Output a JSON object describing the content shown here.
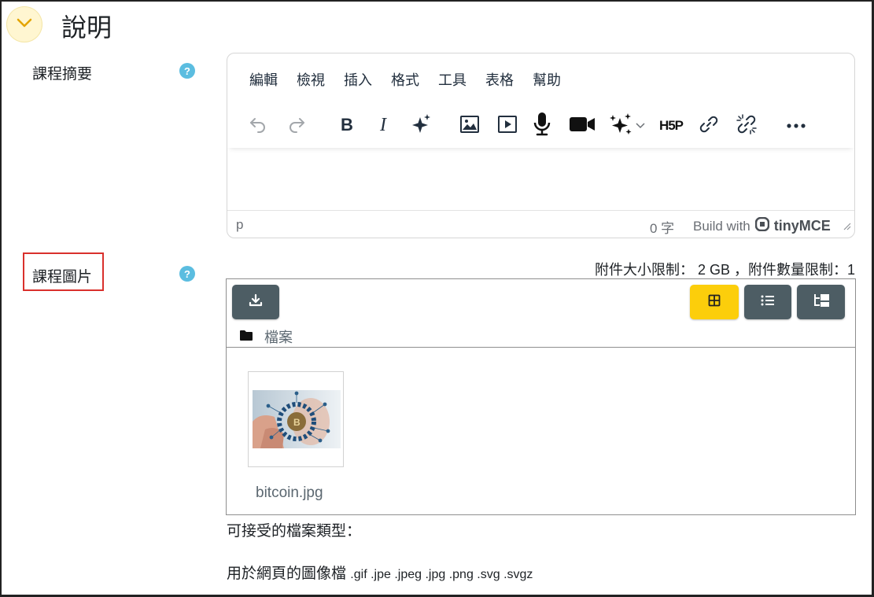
{
  "section": {
    "title": "說明"
  },
  "summary": {
    "label": "課程摘要"
  },
  "editor": {
    "menus": [
      "編輯",
      "檢視",
      "插入",
      "格式",
      "工具",
      "表格",
      "幫助"
    ],
    "toolbar_icons": [
      "undo-icon",
      "redo-icon",
      "bold-icon",
      "italic-icon",
      "ai-sparkle-icon",
      "image-icon",
      "media-icon",
      "microphone-icon",
      "video-camera-icon",
      "ai-tools-icon",
      "h5p-icon",
      "link-icon",
      "unlink-icon",
      "more-icon"
    ],
    "h5p_label": "H5P",
    "status_path": "p",
    "word_count": "0 字",
    "build_with": "Build with",
    "brand": "tinyMCE"
  },
  "image_field": {
    "label": "課程圖片",
    "limits": "附件大小限制： 2 GB ，附件數量限制：1",
    "folder": "檔案",
    "file_name": "bitcoin.jpg",
    "accepted_title": "可接受的檔案類型：",
    "type_group": "用於網頁的圖像檔",
    "extensions": ".gif .jpe .jpeg .jpg .png .svg .svgz"
  },
  "colors": {
    "accent_yellow": "#fcce0b",
    "button_dark": "#4d5d64",
    "help_blue": "#5bbde0",
    "highlight_red": "#d9302c"
  }
}
